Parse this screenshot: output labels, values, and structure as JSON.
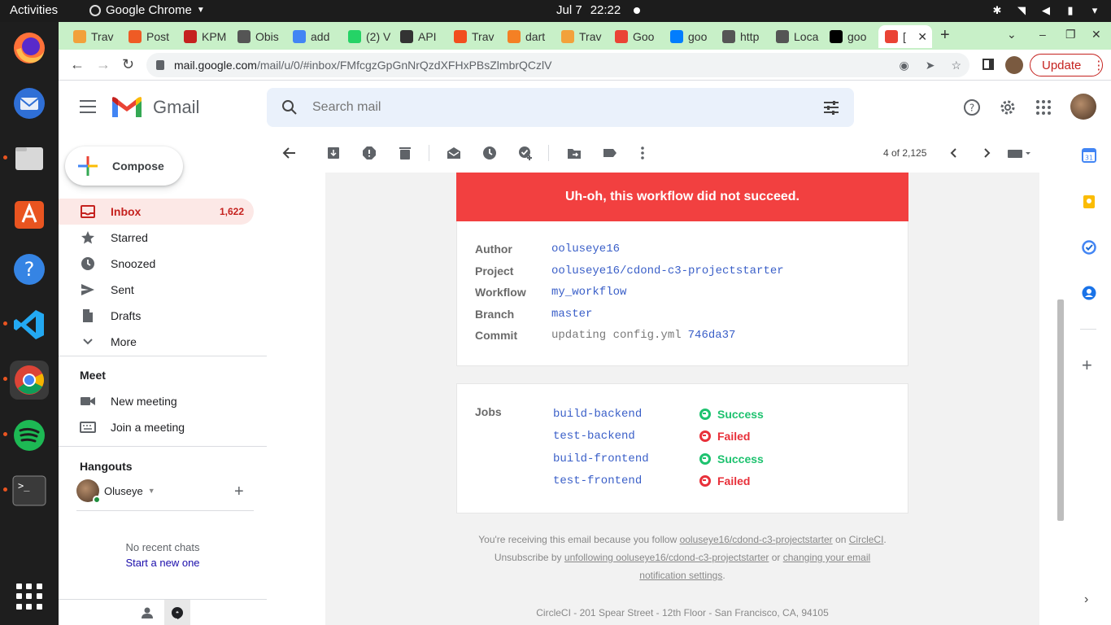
{
  "system": {
    "activities": "Activities",
    "app_menu": "Google Chrome",
    "date": "Jul 7",
    "time": "22:22"
  },
  "browser": {
    "tabs": [
      {
        "label": "Trav",
        "favicon_color": "#f2a13b"
      },
      {
        "label": "Post",
        "favicon_color": "#ef5b25"
      },
      {
        "label": "KPM",
        "favicon_color": "#c5221f"
      },
      {
        "label": "Obis",
        "favicon_color": "#555555"
      },
      {
        "label": "add",
        "favicon_color": "#4285f4"
      },
      {
        "label": "(2) V",
        "favicon_color": "#25d366"
      },
      {
        "label": "API",
        "favicon_color": "#333333"
      },
      {
        "label": "Trav",
        "favicon_color": "#f24e1e"
      },
      {
        "label": "dart",
        "favicon_color": "#f48024"
      },
      {
        "label": "Trav",
        "favicon_color": "#f2a13b"
      },
      {
        "label": "Goo",
        "favicon_color": "#ea4335"
      },
      {
        "label": "goo",
        "favicon_color": "#027dfd"
      },
      {
        "label": "http",
        "favicon_color": "#555555"
      },
      {
        "label": "Loca",
        "favicon_color": "#555555"
      },
      {
        "label": "goo",
        "favicon_color": "#000000"
      },
      {
        "label": "[",
        "favicon_color": "#ea4335",
        "active": true
      }
    ],
    "url_host": "mail.google.com",
    "url_path": "/mail/u/0/#inbox/FMfcgzGpGnNrQzdXFHxPBsZlmbrQCzlV",
    "update_label": "Update"
  },
  "gmail": {
    "product_name": "Gmail",
    "search_placeholder": "Search mail",
    "compose_label": "Compose",
    "nav": [
      {
        "label": "Inbox",
        "count": "1,622",
        "icon": "inbox-icon"
      },
      {
        "label": "Starred",
        "icon": "star-icon"
      },
      {
        "label": "Snoozed",
        "icon": "clock-icon"
      },
      {
        "label": "Sent",
        "icon": "send-icon"
      },
      {
        "label": "Drafts",
        "icon": "draft-icon"
      },
      {
        "label": "More",
        "icon": "chevron-down-icon"
      }
    ],
    "meet": {
      "title": "Meet",
      "new_meeting": "New meeting",
      "join_meeting": "Join a meeting"
    },
    "hangouts": {
      "title": "Hangouts",
      "user": "Oluseye",
      "no_chats": "No recent chats",
      "start_new": "Start a new one"
    },
    "pager": "4 of 2,125"
  },
  "email": {
    "banner": "Uh-oh, this workflow did not succeed.",
    "info": [
      {
        "key": "Author",
        "value": "ooluseye16"
      },
      {
        "key": "Project",
        "value": "ooluseye16/cdond-c3-projectstarter"
      },
      {
        "key": "Workflow",
        "value": "my_workflow"
      },
      {
        "key": "Branch",
        "value": "master"
      },
      {
        "key": "Commit",
        "value_grey": "updating config.yml",
        "value": "746da37"
      }
    ],
    "jobs_title": "Jobs",
    "jobs": [
      {
        "name": "build-backend",
        "status": "Success"
      },
      {
        "name": "test-backend",
        "status": "Failed"
      },
      {
        "name": "build-frontend",
        "status": "Success"
      },
      {
        "name": "test-frontend",
        "status": "Failed"
      }
    ],
    "footer": {
      "line1_a": "You're receiving this email because you follow",
      "line1_link": "ooluseye16/cdond-c3-projectstarter",
      "line1_b": "on",
      "line1_link2": "CircleCI",
      "line1_end": ".",
      "line2_a": "Unsubscribe by",
      "line2_link": "unfollowing ooluseye16/cdond-c3-projectstarter",
      "line2_b": "or",
      "line2_link2": "changing your email",
      "line3_link": "notification settings",
      "line3_end": "."
    },
    "address": "CircleCI - 201 Spear Street - 12th Floor - San Francisco, CA, 94105"
  },
  "colors": {
    "banner_red": "#f24040",
    "success_green": "#1ec26f",
    "failed_red": "#e8303a",
    "link_blue": "#3a5fc8",
    "tabbar_green": "#c8f0c8"
  }
}
